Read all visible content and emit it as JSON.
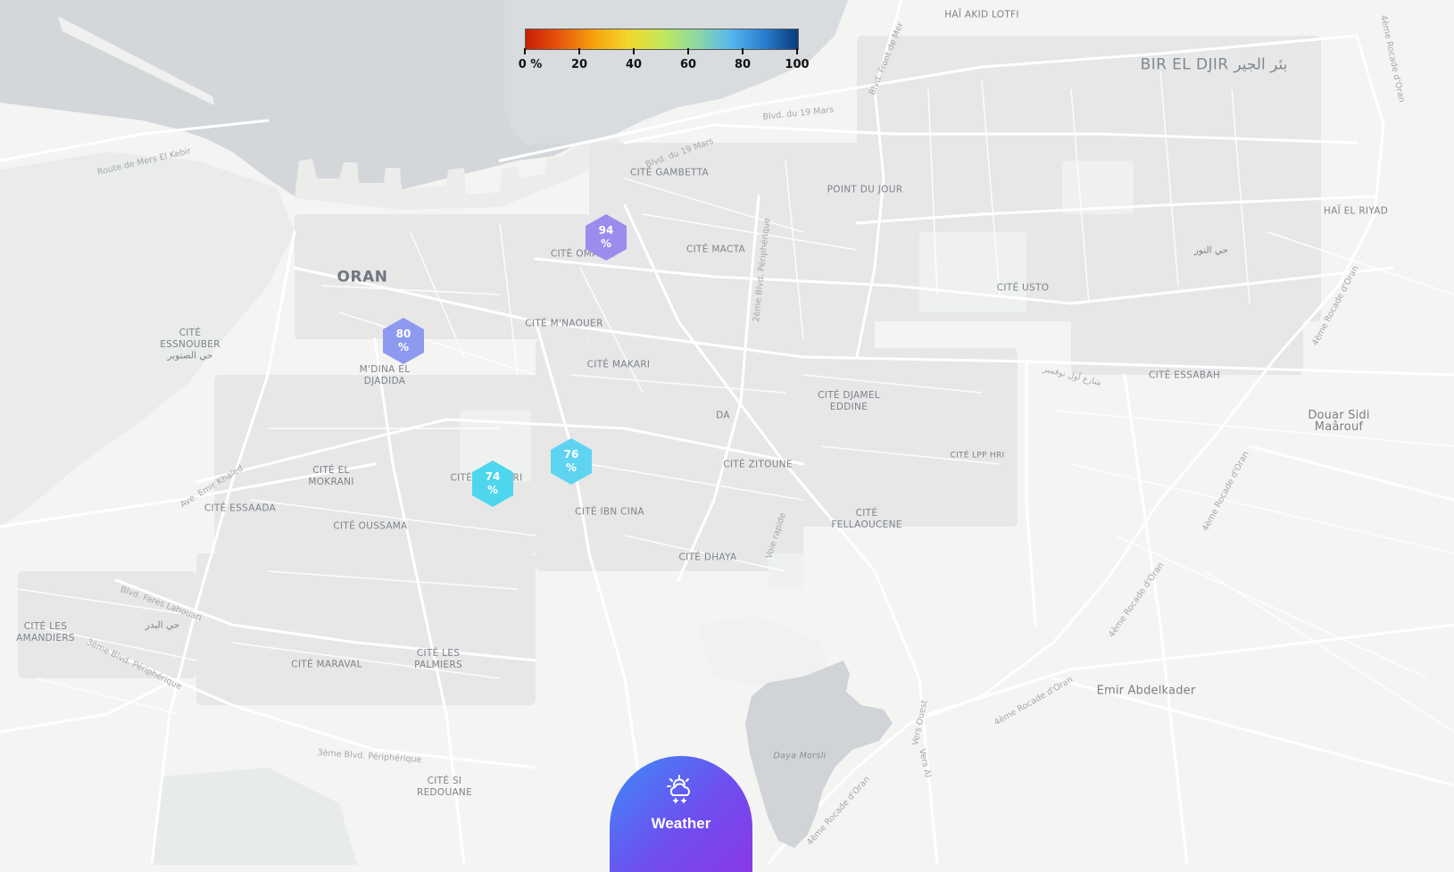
{
  "legend": {
    "gradient": [
      "#c81e06",
      "#e8560a",
      "#f7a20d",
      "#f2d62a",
      "#c4e85a",
      "#8fd9a0",
      "#56b8ee",
      "#2a7fd0",
      "#083c7a"
    ],
    "ticks": [
      {
        "value": 0,
        "label": "0 %"
      },
      {
        "value": 20,
        "label": "20"
      },
      {
        "value": 40,
        "label": "40"
      },
      {
        "value": 60,
        "label": "60"
      },
      {
        "value": 80,
        "label": "80"
      },
      {
        "value": 100,
        "label": "100"
      }
    ]
  },
  "markers": [
    {
      "id": "cite-omaria",
      "value": 94,
      "line1": "94",
      "line2": "%",
      "color": "#9b8cee"
    },
    {
      "id": "mdina-el-djadida",
      "value": 80,
      "line1": "80",
      "line2": "%",
      "color": "#8e9af0"
    },
    {
      "id": "cite-ibn-cina",
      "value": 76,
      "line1": "76",
      "line2": "%",
      "color": "#5ed4f1"
    },
    {
      "id": "cite-el-hamri",
      "value": 74,
      "line1": "74",
      "line2": "%",
      "color": "#4dd6ee"
    }
  ],
  "places": {
    "oran": "ORAN",
    "bir_el_djir": "BIR EL DJIR بئر الجير",
    "hai_akid_lotfi": "HAÏ AKID LOTFI",
    "cite_gambetta": "CITÉ GAMBETTA",
    "point_du_jour": "POINT DU JOUR",
    "hai_el_riyad": "HAÏ EL RIYAD",
    "hay_ennour_ar": "حي النور",
    "cite_omaria": "CITÉ OMARIA",
    "cite_macta": "CITÉ MACTA",
    "cite_usto": "CITÉ USTO",
    "cite_essnouber": "CITÉ\nESSNOUBER",
    "hay_essnouber_ar": "حي الصنوبر",
    "cite_mnaouer": "CITÉ M'NAOUER",
    "mdina": "M'DINA EL\nDJADIDA",
    "cite_makari": "CITÉ MAKARI",
    "cite_djamel": "CITÉ DJAMEL\nEDDINE",
    "cite_essabah": "CITÉ ESSABAH",
    "douar_sidi": "Douar Sidi\nMaârouf",
    "da": "DA",
    "cite_el_mokrani": "CITÉ EL\nMOKRANI",
    "cite_el_hamri": "CITÉ EL HAMRI",
    "cite_zitoune": "CITÉ ZITOUNE",
    "cite_lpp_hri": "CITÉ LPP HRI",
    "cite_essaada": "CITÉ ESSAADA",
    "cite_ibn_cina": "CITÉ IBN CINA",
    "cite_fellaoucene": "CITÉ\nFELLAOUCENE",
    "cite_oussama": "CITÉ OUSSAMA",
    "cite_dhaya": "CITÉ DHAYA",
    "cite_les_amandiers": "CITÉ LES\nAMANDIERS",
    "hay_el_badr_ar": "حي البدر",
    "cite_maraval": "CITÉ MARAVAL",
    "cite_les_palmiers": "CITÉ LES\nPALMIERS",
    "emir_abdelkader": "Emir Abdelkader",
    "cite_si_redouane": "CITÉ SI\nREDOUANE",
    "daya_morsli": "Daya Morsli"
  },
  "roads": {
    "route_mers": "Route de Mers El Kebir",
    "blvd_19_mars_a": "Blvd. du 19 Mars",
    "blvd_19_mars_b": "Blvd. du 19 Mars",
    "blvd_front_mer": "Blvd. Front de Mer",
    "rocade_4_a": "4ème Rocade d'Oran",
    "rocade_4_b": "4ème Rocade d'Oran",
    "rocade_4_c": "4ème Rocade d'Oran",
    "rocade_4_d": "4ème Rocade d'Oran",
    "rocade_4_e": "4ème Rocade d'Oran",
    "rocade_4_f": "4ème Rocade d'Oran",
    "blvd_peri_2": "2ème Blvd. Périphérique",
    "ave_emir": "Ave. Emir Khaled",
    "shari_nov_ar": "شارع أول نوفمبر",
    "voie_rapide": "Voie rapide",
    "blvd_fares": "Blvd. Fares Lahouari",
    "blvd_peri_3a": "3ème Blvd. Périphérique",
    "blvd_peri_3b": "3ème Blvd. Périphérique",
    "vers_ouest": "Vers Ouest",
    "vers_al": "Vers Al"
  },
  "weather_button": {
    "label": "Weather",
    "icon": "weather-icon"
  }
}
